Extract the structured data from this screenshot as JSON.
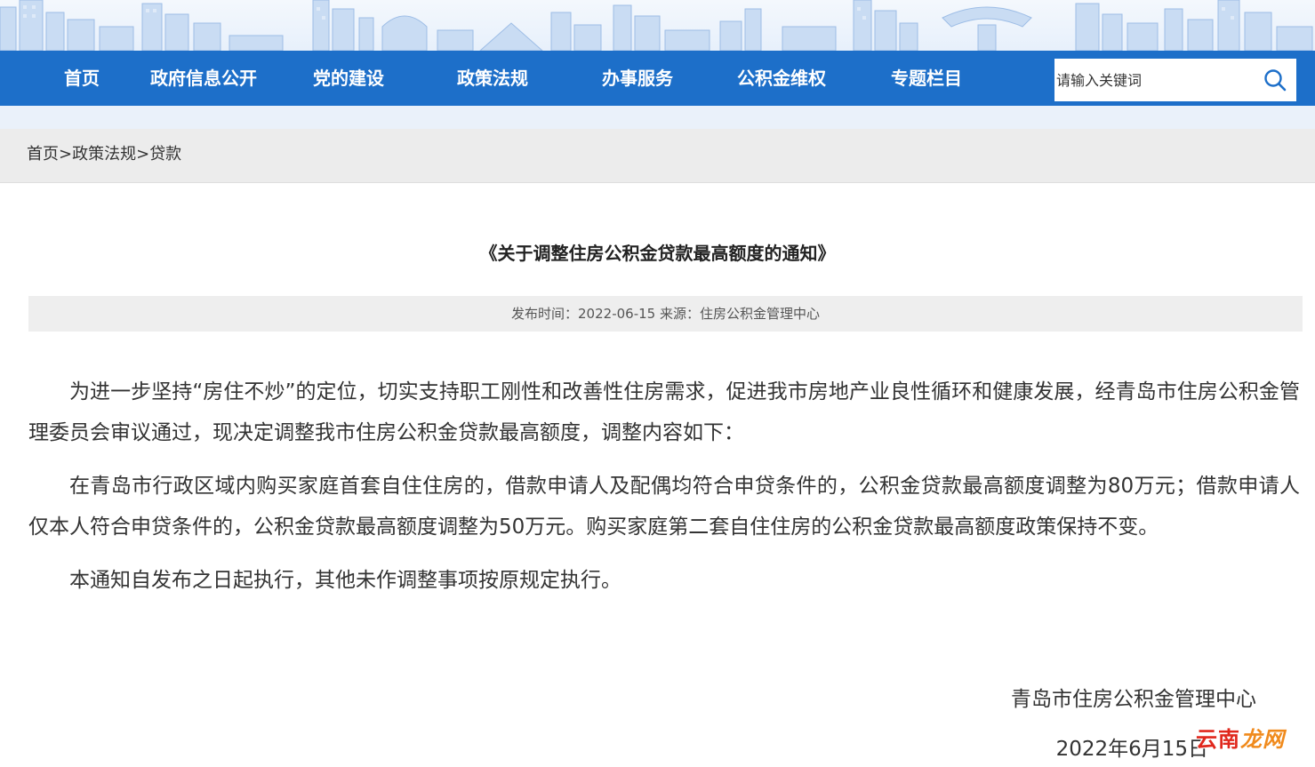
{
  "colors": {
    "nav_background": "#1d6fc9",
    "nav_text": "#ffffff",
    "breadcrumb_background": "#ececec",
    "meta_background": "#eeeeee",
    "watermark_red": "#e0281d",
    "watermark_orange": "#f08a1c"
  },
  "nav": {
    "items": [
      {
        "label": "首页"
      },
      {
        "label": "政府信息公开"
      },
      {
        "label": "党的建设"
      },
      {
        "label": "政策法规"
      },
      {
        "label": "办事服务"
      },
      {
        "label": "公积金维权"
      },
      {
        "label": "专题栏目"
      }
    ]
  },
  "search": {
    "placeholder": "请输入关键词",
    "icon": "search-icon"
  },
  "breadcrumb": {
    "home": "首页",
    "separator": ">",
    "section": "政策法规",
    "current": "贷款"
  },
  "article": {
    "title": "《关于调整住房公积金贷款最高额度的通知》",
    "meta": "发布时间：2022-06-15 来源：住房公积金管理中心",
    "paragraphs": [
      "为进一步坚持“房住不炒”的定位，切实支持职工刚性和改善性住房需求，促进我市房地产业良性循环和健康发展，经青岛市住房公积金管理委员会审议通过，现决定调整我市住房公积金贷款最高额度，调整内容如下：",
      "在青岛市行政区域内购买家庭首套自住住房的，借款申请人及配偶均符合申贷条件的，公积金贷款最高额度调整为80万元；借款申请人仅本人符合申贷条件的，公积金贷款最高额度调整为50万元。购买家庭第二套自住住房的公积金贷款最高额度政策保持不变。",
      "本通知自发布之日起执行，其他未作调整事项按原规定执行。"
    ],
    "signature": "青岛市住房公积金管理中心",
    "date": "2022年6月15日"
  },
  "watermark": {
    "part1": "云南",
    "part2": "龙网"
  }
}
